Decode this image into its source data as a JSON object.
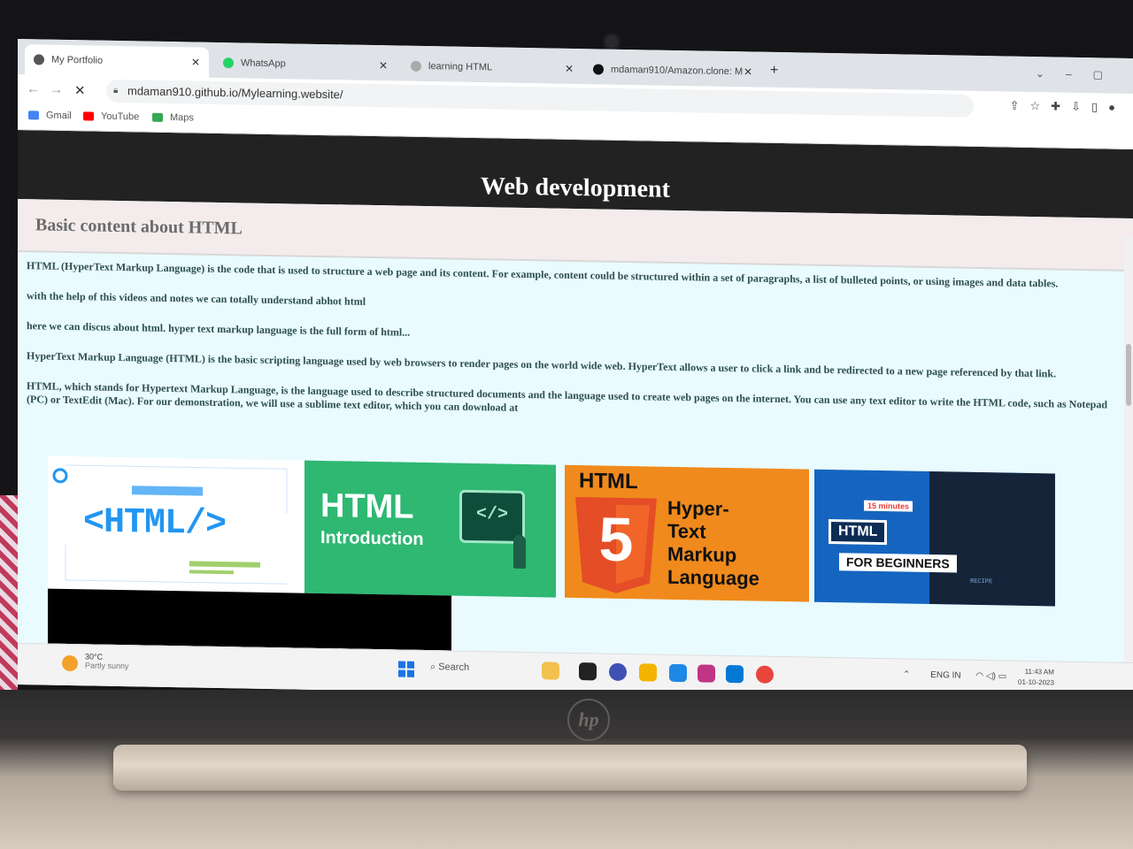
{
  "tabs": [
    {
      "title": "My Portfolio",
      "icon": "globe-icon",
      "color": "#555555"
    },
    {
      "title": "WhatsApp",
      "icon": "whatsapp-icon",
      "color": "#25d366"
    },
    {
      "title": "learning HTML",
      "icon": "loading-icon",
      "color": "#888888"
    },
    {
      "title": "mdaman910/Amazon.clone: M",
      "icon": "github-icon",
      "color": "#111111"
    }
  ],
  "address": {
    "url": "mdaman910.github.io/Mylearning.website/"
  },
  "bookmarks": [
    {
      "label": "Gmail",
      "icon": "google-icon",
      "color": "#4285f4"
    },
    {
      "label": "YouTube",
      "icon": "youtube-icon",
      "color": "#ff0000"
    },
    {
      "label": "Maps",
      "icon": "maps-icon",
      "color": "#34a853"
    }
  ],
  "page": {
    "header": "Web development",
    "section_title": "Basic content about HTML",
    "paragraphs": [
      "HTML (HyperText Markup Language) is the code that is used to structure a web page and its content. For example, content could be structured within a set of paragraphs, a list of bulleted points, or using images and data tables.",
      "with the help of this videos and notes we can totally understand abhot html",
      "here we can discus about html. hyper text markup language is the full form of html...",
      "HyperText Markup Language (HTML) is the basic scripting language used by web browsers to render pages on the world wide web. HyperText allows a user to click a link and be redirected to a new page referenced by that link.",
      "HTML, which stands for Hypertext Markup Language, is the language used to describe structured documents and the language used to create web pages on the internet. You can use any text editor to write the HTML code, such as Notepad (PC) or TextEdit (Mac). For our demonstration, we will use a sublime text editor, which you can download at"
    ],
    "images": {
      "img1": {
        "text": "<HTML/>",
        "accent": "#2196f3"
      },
      "img2": {
        "title": "HTML",
        "subtitle": "Introduction",
        "bg": "#2eb872",
        "code": "</>"
      },
      "img3": {
        "heading": "HTML",
        "badge": "5",
        "lines": [
          "Hyper-",
          "Text",
          "Markup",
          "Language"
        ],
        "bg": "#f08a1c"
      },
      "img4": {
        "badge_time": "15 minutes",
        "label_html": "HTML",
        "label_beginners": "FOR BEGINNERS",
        "bg": "#1565c0",
        "code_tag": "RECIPE"
      }
    }
  },
  "taskbar": {
    "weather_temp": "30°C",
    "weather_desc": "Partly sunny",
    "search": "Search",
    "lang1": "ENG",
    "lang2": "IN",
    "time": "11:43 AM",
    "date": "01-10-2023"
  }
}
